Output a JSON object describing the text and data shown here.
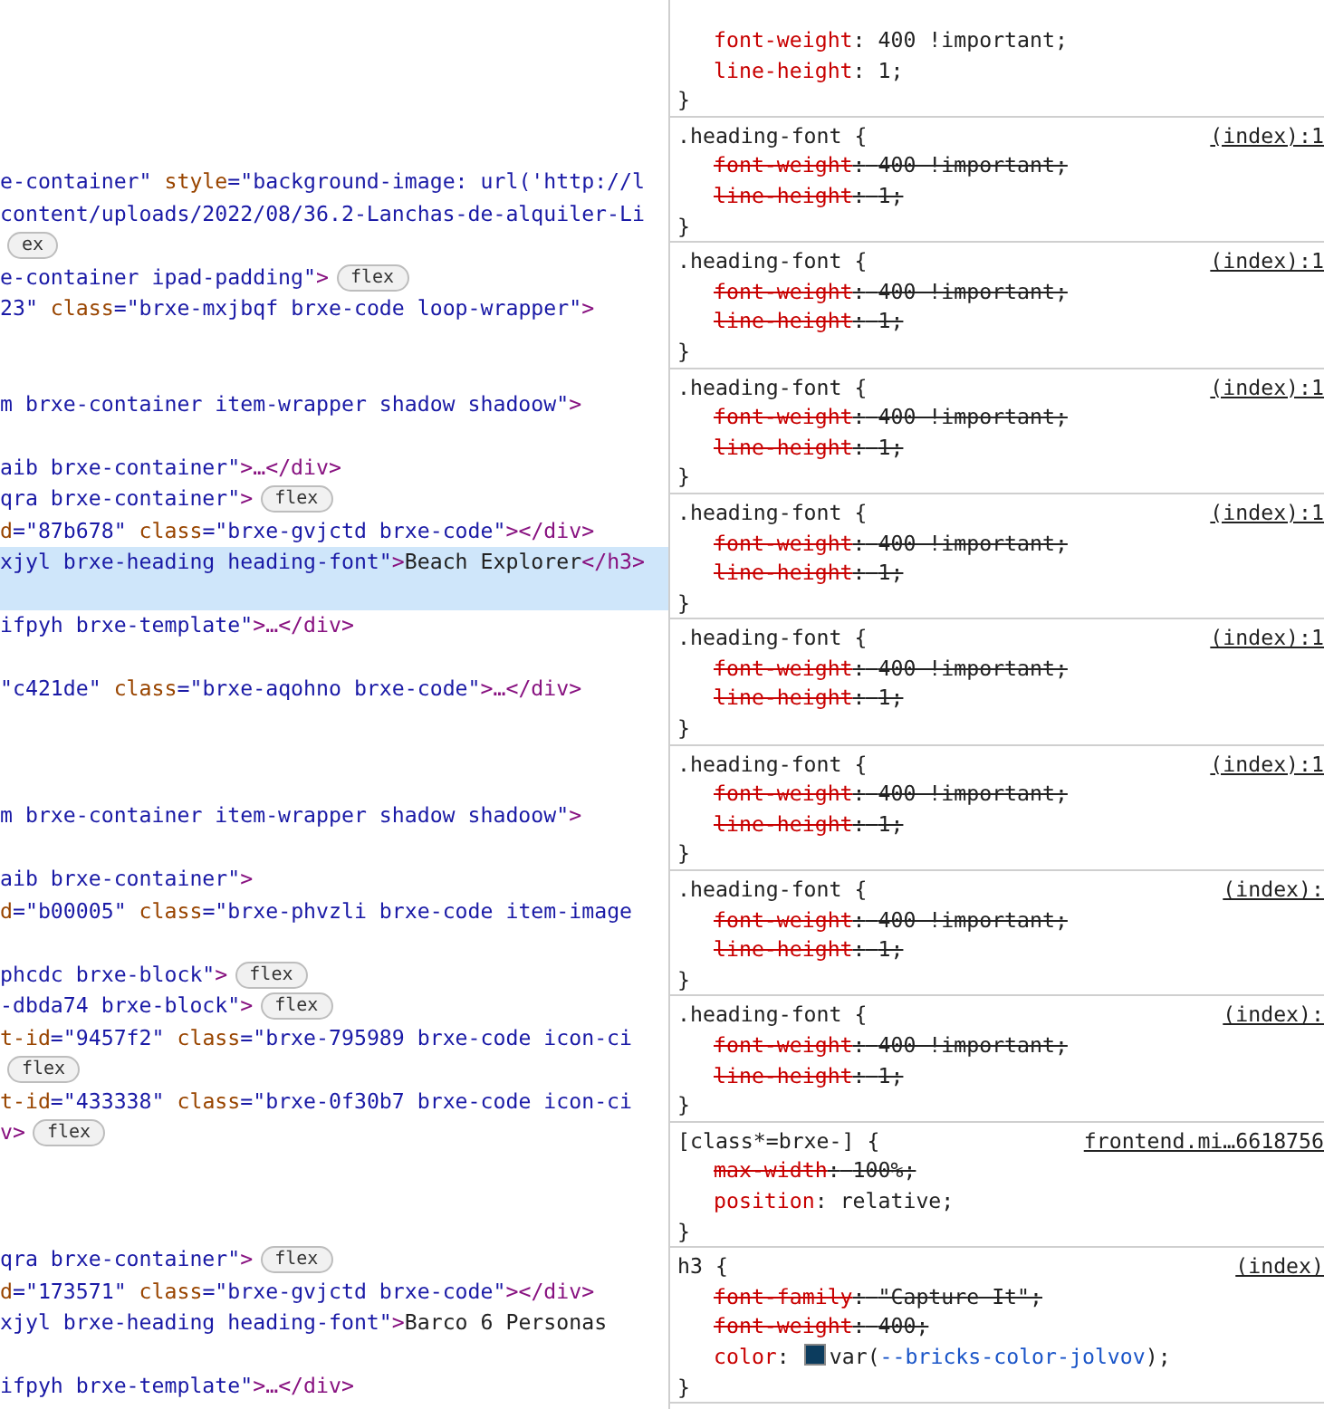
{
  "elements_panel": {
    "lines": [
      {
        "kind": "code",
        "selected": false,
        "segments": [
          {
            "kind": "str",
            "t": "e-container\""
          },
          {
            "kind": "attr",
            "t": " style"
          },
          {
            "kind": "str",
            "t": "=\"background-image: url('http://l"
          }
        ]
      },
      {
        "kind": "code",
        "selected": false,
        "segments": [
          {
            "kind": "str",
            "t": "content/uploads/2022/08/36.2-Lanchas-de-alquiler-Li"
          }
        ]
      },
      {
        "kind": "code",
        "selected": false,
        "segments": [
          {
            "kind": "badge",
            "t": "ex"
          }
        ]
      },
      {
        "kind": "code",
        "selected": false,
        "segments": [
          {
            "kind": "str",
            "t": "e-container ipad-padding\""
          },
          {
            "kind": "tag",
            "t": ">"
          },
          {
            "kind": "badge",
            "t": "flex"
          }
        ]
      },
      {
        "kind": "code",
        "selected": false,
        "segments": [
          {
            "kind": "str",
            "t": "23\""
          },
          {
            "kind": "attr",
            "t": " class"
          },
          {
            "kind": "str",
            "t": "=\"brxe-mxjbqf brxe-code loop-wrapper\""
          },
          {
            "kind": "tag",
            "t": ">"
          }
        ]
      },
      {
        "kind": "blank",
        "selected": false
      },
      {
        "kind": "blank",
        "selected": false
      },
      {
        "kind": "code",
        "selected": false,
        "segments": [
          {
            "kind": "str",
            "t": "m brxe-container item-wrapper shadow shadoow\""
          },
          {
            "kind": "tag",
            "t": ">"
          }
        ]
      },
      {
        "kind": "blank",
        "selected": false
      },
      {
        "kind": "code",
        "selected": false,
        "segments": [
          {
            "kind": "str",
            "t": "aib brxe-container\""
          },
          {
            "kind": "tag",
            "t": ">…</div>"
          }
        ]
      },
      {
        "kind": "code",
        "selected": false,
        "segments": [
          {
            "kind": "str",
            "t": "qra brxe-container\""
          },
          {
            "kind": "tag",
            "t": ">"
          },
          {
            "kind": "badge",
            "t": "flex"
          }
        ]
      },
      {
        "kind": "code",
        "selected": false,
        "segments": [
          {
            "kind": "attr",
            "t": "d"
          },
          {
            "kind": "str",
            "t": "=\"87b678\""
          },
          {
            "kind": "attr",
            "t": " class"
          },
          {
            "kind": "str",
            "t": "=\"brxe-gvjctd brxe-code\""
          },
          {
            "kind": "tag",
            "t": "></div>"
          }
        ]
      },
      {
        "kind": "code",
        "selected": true,
        "segments": [
          {
            "kind": "str",
            "t": "xjyl brxe-heading heading-font\""
          },
          {
            "kind": "tag",
            "t": ">"
          },
          {
            "kind": "text",
            "t": "Beach Explorer"
          },
          {
            "kind": "tag",
            "t": "</h3>"
          }
        ]
      },
      {
        "kind": "blank",
        "selected": true
      },
      {
        "kind": "code",
        "selected": false,
        "segments": [
          {
            "kind": "str",
            "t": "ifpyh brxe-template\""
          },
          {
            "kind": "tag",
            "t": ">…</div>"
          }
        ]
      },
      {
        "kind": "blank",
        "selected": false
      },
      {
        "kind": "code",
        "selected": false,
        "segments": [
          {
            "kind": "str",
            "t": "\"c421de\""
          },
          {
            "kind": "attr",
            "t": " class"
          },
          {
            "kind": "str",
            "t": "=\"brxe-aqohno brxe-code\""
          },
          {
            "kind": "tag",
            "t": ">…</div>"
          }
        ]
      },
      {
        "kind": "blank",
        "selected": false
      },
      {
        "kind": "blank",
        "selected": false
      },
      {
        "kind": "blank",
        "selected": false
      },
      {
        "kind": "code",
        "selected": false,
        "segments": [
          {
            "kind": "str",
            "t": "m brxe-container item-wrapper shadow shadoow\""
          },
          {
            "kind": "tag",
            "t": ">"
          }
        ]
      },
      {
        "kind": "blank",
        "selected": false
      },
      {
        "kind": "code",
        "selected": false,
        "segments": [
          {
            "kind": "str",
            "t": "aib brxe-container\""
          },
          {
            "kind": "tag",
            "t": ">"
          }
        ]
      },
      {
        "kind": "code",
        "selected": false,
        "segments": [
          {
            "kind": "attr",
            "t": "d"
          },
          {
            "kind": "str",
            "t": "=\"b00005\""
          },
          {
            "kind": "attr",
            "t": " class"
          },
          {
            "kind": "str",
            "t": "=\"brxe-phvzli brxe-code item-image"
          }
        ]
      },
      {
        "kind": "blank",
        "selected": false
      },
      {
        "kind": "code",
        "selected": false,
        "segments": [
          {
            "kind": "str",
            "t": "phcdc brxe-block\""
          },
          {
            "kind": "tag",
            "t": ">"
          },
          {
            "kind": "badge",
            "t": "flex"
          }
        ]
      },
      {
        "kind": "code",
        "selected": false,
        "segments": [
          {
            "kind": "str",
            "t": "-dbda74 brxe-block\""
          },
          {
            "kind": "tag",
            "t": ">"
          },
          {
            "kind": "badge",
            "t": "flex"
          }
        ]
      },
      {
        "kind": "code",
        "selected": false,
        "segments": [
          {
            "kind": "attr",
            "t": "t-id"
          },
          {
            "kind": "str",
            "t": "=\"9457f2\""
          },
          {
            "kind": "attr",
            "t": " class"
          },
          {
            "kind": "str",
            "t": "=\"brxe-795989 brxe-code icon-ci"
          }
        ]
      },
      {
        "kind": "code",
        "selected": false,
        "segments": [
          {
            "kind": "badge",
            "t": "flex"
          }
        ]
      },
      {
        "kind": "code",
        "selected": false,
        "segments": [
          {
            "kind": "attr",
            "t": "t-id"
          },
          {
            "kind": "str",
            "t": "=\"433338\""
          },
          {
            "kind": "attr",
            "t": " class"
          },
          {
            "kind": "str",
            "t": "=\"brxe-0f30b7 brxe-code icon-ci"
          }
        ]
      },
      {
        "kind": "code",
        "selected": false,
        "segments": [
          {
            "kind": "tag",
            "t": "v>"
          },
          {
            "kind": "badge",
            "t": "flex"
          }
        ]
      },
      {
        "kind": "blank",
        "selected": false
      },
      {
        "kind": "blank",
        "selected": false
      },
      {
        "kind": "blank",
        "selected": false
      },
      {
        "kind": "code",
        "selected": false,
        "segments": [
          {
            "kind": "str",
            "t": "qra brxe-container\""
          },
          {
            "kind": "tag",
            "t": ">"
          },
          {
            "kind": "badge",
            "t": "flex"
          }
        ]
      },
      {
        "kind": "code",
        "selected": false,
        "segments": [
          {
            "kind": "attr",
            "t": "d"
          },
          {
            "kind": "str",
            "t": "=\"173571\""
          },
          {
            "kind": "attr",
            "t": " class"
          },
          {
            "kind": "str",
            "t": "=\"brxe-gvjctd brxe-code\""
          },
          {
            "kind": "tag",
            "t": "></div>"
          }
        ]
      },
      {
        "kind": "code",
        "selected": false,
        "segments": [
          {
            "kind": "str",
            "t": "xjyl brxe-heading heading-font\""
          },
          {
            "kind": "tag",
            "t": ">"
          },
          {
            "kind": "text",
            "t": "Barco 6 Personas"
          }
        ]
      },
      {
        "kind": "blank",
        "selected": false
      },
      {
        "kind": "code",
        "selected": false,
        "segments": [
          {
            "kind": "str",
            "t": "ifpyh brxe-template\""
          },
          {
            "kind": "tag",
            "t": ">…</div>"
          }
        ]
      }
    ]
  },
  "styles_panel": {
    "rules": [
      {
        "close": "}",
        "properties": [
          {
            "name": "font-weight",
            "separator": ":",
            "value": "400 !important;",
            "overridden": false
          },
          {
            "name": "line-height",
            "separator": ":",
            "value": "1;",
            "overridden": false
          }
        ]
      },
      {
        "selector": ".heading-font {",
        "source": "(index):1",
        "close": "}",
        "properties": [
          {
            "name": "font-weight",
            "separator": ":",
            "value": "400 !important;",
            "overridden": true
          },
          {
            "name": "line-height",
            "separator": ":",
            "value": "1;",
            "overridden": true
          }
        ]
      },
      {
        "selector": ".heading-font {",
        "source": "(index):1",
        "close": "}",
        "properties": [
          {
            "name": "font-weight",
            "separator": ":",
            "value": "400 !important;",
            "overridden": true
          },
          {
            "name": "line-height",
            "separator": ":",
            "value": "1;",
            "overridden": true
          }
        ]
      },
      {
        "selector": ".heading-font {",
        "source": "(index):1",
        "close": "}",
        "properties": [
          {
            "name": "font-weight",
            "separator": ":",
            "value": "400 !important;",
            "overridden": true
          },
          {
            "name": "line-height",
            "separator": ":",
            "value": "1;",
            "overridden": true
          }
        ]
      },
      {
        "selector": ".heading-font {",
        "source": "(index):1",
        "close": "}",
        "properties": [
          {
            "name": "font-weight",
            "separator": ":",
            "value": "400 !important;",
            "overridden": true
          },
          {
            "name": "line-height",
            "separator": ":",
            "value": "1;",
            "overridden": true
          }
        ]
      },
      {
        "selector": ".heading-font {",
        "source": "(index):1",
        "close": "}",
        "properties": [
          {
            "name": "font-weight",
            "separator": ":",
            "value": "400 !important;",
            "overridden": true
          },
          {
            "name": "line-height",
            "separator": ":",
            "value": "1;",
            "overridden": true
          }
        ]
      },
      {
        "selector": ".heading-font {",
        "source": "(index):1",
        "close": "}",
        "properties": [
          {
            "name": "font-weight",
            "separator": ":",
            "value": "400 !important;",
            "overridden": true
          },
          {
            "name": "line-height",
            "separator": ":",
            "value": "1;",
            "overridden": true
          }
        ]
      },
      {
        "selector": ".heading-font {",
        "source": "(index):",
        "close": "}",
        "properties": [
          {
            "name": "font-weight",
            "separator": ":",
            "value": "400 !important;",
            "overridden": true
          },
          {
            "name": "line-height",
            "separator": ":",
            "value": "1;",
            "overridden": true
          }
        ]
      },
      {
        "selector": ".heading-font {",
        "source": "(index):",
        "close": "}",
        "properties": [
          {
            "name": "font-weight",
            "separator": ":",
            "value": "400 !important;",
            "overridden": true
          },
          {
            "name": "line-height",
            "separator": ":",
            "value": "1;",
            "overridden": true
          }
        ]
      },
      {
        "selector": "[class*=brxe-] {",
        "source": "frontend.mi…6618756",
        "close": "}",
        "properties": [
          {
            "name": "max-width",
            "separator": ":",
            "value": "100%;",
            "overridden": true
          },
          {
            "name": "position",
            "separator": ":",
            "value": "relative;",
            "overridden": false
          }
        ]
      },
      {
        "selector": "h3 {",
        "source": "(index)",
        "close": "}",
        "properties": [
          {
            "name": "font-family",
            "separator": ":",
            "value": "\"Capture It\";",
            "overridden": true
          },
          {
            "name": "font-weight",
            "separator": ":",
            "value": "400;",
            "overridden": true
          },
          {
            "name": "color",
            "separator": ":",
            "color": "#0c3c5e",
            "value_prefix": "var(",
            "value_variable": "--bricks-color-jolvov",
            "value_suffix": ");",
            "overridden": false
          }
        ]
      }
    ]
  }
}
